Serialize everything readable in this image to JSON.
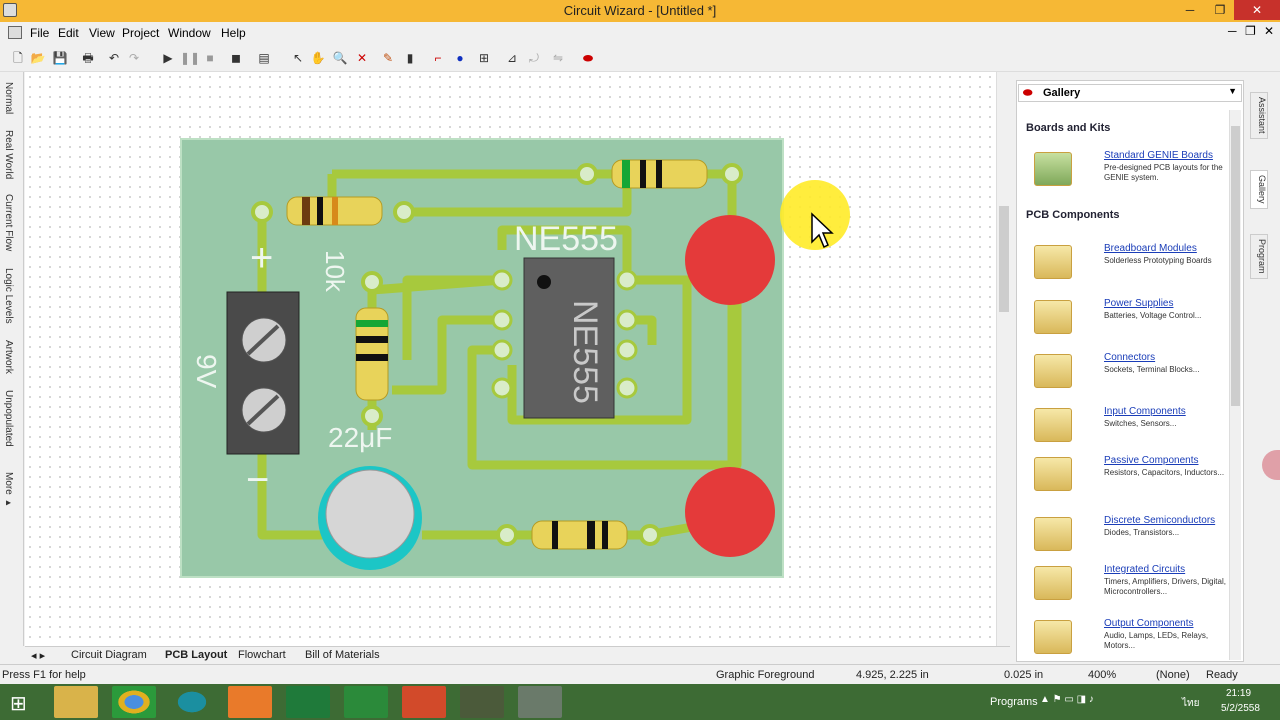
{
  "window": {
    "title": "Circuit Wizard - [Untitled *]",
    "minimize": "─",
    "maximize": "❐",
    "close": "✕"
  },
  "menu": {
    "file": "File",
    "edit": "Edit",
    "view": "View",
    "project": "Project",
    "window": "Window",
    "help": "Help"
  },
  "mdi_controls": {
    "minimize": "─",
    "restore": "❐",
    "close": "✕"
  },
  "left_tabs": [
    "Normal",
    "Real World",
    "Current Flow",
    "Logic Levels",
    "Artwork",
    "Unpopulated",
    "More ▸"
  ],
  "pcb": {
    "ic_label": "NE555",
    "ic_body_label": "NE555",
    "resistor_label": "10k",
    "battery_label": "9V",
    "capacitor_label": "22μF",
    "battery_plus": "+",
    "battery_minus": "−"
  },
  "gallery": {
    "title": "Gallery",
    "sections": [
      {
        "heading": "Boards and Kits",
        "items": [
          {
            "name": "Standard GENIE Boards",
            "desc": "Pre-designed PCB layouts for the GENIE system."
          }
        ]
      },
      {
        "heading": "PCB Components",
        "items": [
          {
            "name": "Breadboard Modules",
            "desc": "Solderless Prototyping Boards"
          },
          {
            "name": "Power Supplies",
            "desc": "Batteries, Voltage Control..."
          },
          {
            "name": "Connectors",
            "desc": "Sockets, Terminal Blocks..."
          },
          {
            "name": "Input Components",
            "desc": "Switches, Sensors..."
          },
          {
            "name": "Passive Components",
            "desc": "Resistors, Capacitors, Inductors..."
          },
          {
            "name": "Discrete Semiconductors",
            "desc": "Diodes, Transistors..."
          },
          {
            "name": "Integrated Circuits",
            "desc": "Timers, Amplifiers, Drivers, Digital, Microcontrollers..."
          },
          {
            "name": "Output Components",
            "desc": "Audio, Lamps, LEDs, Relays, Motors..."
          }
        ]
      }
    ]
  },
  "right_tabs": [
    "Assistant",
    "Gallery",
    "Program"
  ],
  "bottom_tabs": [
    "Circuit Diagram",
    "PCB Layout",
    "Flowchart",
    "Bill of Materials"
  ],
  "status": {
    "help": "Press F1 for help",
    "layer": "Graphic Foreground",
    "coords": "4.925, 2.225 in",
    "grid": "0.025 in",
    "zoom": "400%",
    "net": "(None)",
    "state": "Ready"
  },
  "taskbar": {
    "programs": "Programs",
    "lang": "ไทย",
    "time": "21:19",
    "date": "5/2/2558"
  }
}
